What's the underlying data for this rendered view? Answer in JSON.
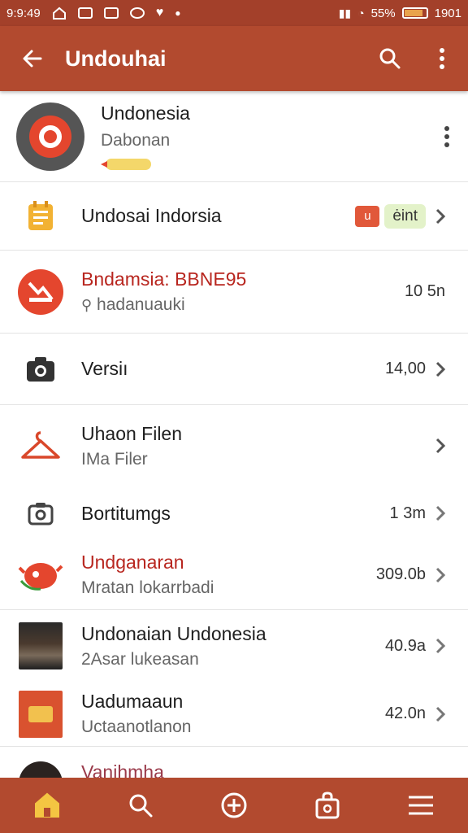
{
  "status_bar": {
    "left_text": "9:9:49",
    "battery_percent": "55%",
    "time": "1901",
    "icons": [
      "home-icon",
      "image-icon",
      "chart-icon",
      "messenger-icon",
      "heart-icon",
      "dot-icon",
      "signal-icon",
      "wifi-icon",
      "battery-icon"
    ]
  },
  "app_bar": {
    "title": "Undouhai",
    "back_icon": "arrow-left-icon",
    "search_icon": "search-icon",
    "menu_icon": "more-vert-icon"
  },
  "profile": {
    "name": "Undonesia",
    "subtitle": "Dabonan",
    "accent": "#e4462e"
  },
  "items": [
    {
      "id": "notes",
      "title": "Undosai Indorsia",
      "subtitle": "",
      "tag_red": "u",
      "tag_green": "ėint",
      "icon": "note-icon",
      "chevron": true
    },
    {
      "id": "chart",
      "title": "Bndamsia: BBNE95",
      "subtitle": "hadanuauki",
      "value": "10 5n",
      "icon": "chart-down-icon",
      "chevron": false,
      "red_title": true
    },
    {
      "id": "version",
      "title": "Versiı",
      "subtitle": "",
      "value": "14,00",
      "icon": "camera-icon",
      "chevron": true
    },
    {
      "id": "files",
      "title": "Uhaon Filen",
      "subtitle": "IMa Filer",
      "value": "",
      "icon": "hanger-icon",
      "chevron": true
    },
    {
      "id": "settings",
      "title": "Bortitumgs",
      "subtitle": "",
      "value": "1 3m",
      "icon": "camera-outline-icon",
      "chevron": true
    },
    {
      "id": "undganaran",
      "title": "Undganaran",
      "subtitle": "Mratan lokarrbadi",
      "value": "309.0b",
      "icon": "bird-icon",
      "chevron": true,
      "red_title": true
    },
    {
      "id": "person",
      "title": "Undonaian Undonesia",
      "subtitle": "2Asar lukeasan",
      "value": "40.9a",
      "icon": "photo-person-thumb",
      "chevron": true
    },
    {
      "id": "book",
      "title": "Uadumaaun",
      "subtitle": "Uctaanotlanon",
      "value": "42.0n",
      "icon": "book-thumb",
      "chevron": true
    },
    {
      "id": "partial",
      "title": "Vanihmha",
      "subtitle": "",
      "value": "",
      "icon": "round-thumb",
      "chevron": false,
      "red_title": true
    }
  ],
  "bottom_nav": [
    {
      "name": "home-icon",
      "label": "Home"
    },
    {
      "name": "search-icon",
      "label": "Search"
    },
    {
      "name": "add-icon",
      "label": "Add"
    },
    {
      "name": "bag-icon",
      "label": "Bag"
    },
    {
      "name": "menu-icon",
      "label": "Menu"
    }
  ],
  "colors": {
    "primary": "#b24a2f",
    "status": "#a3402a",
    "accent_red": "#e4462e",
    "title_red": "#b8261f"
  }
}
